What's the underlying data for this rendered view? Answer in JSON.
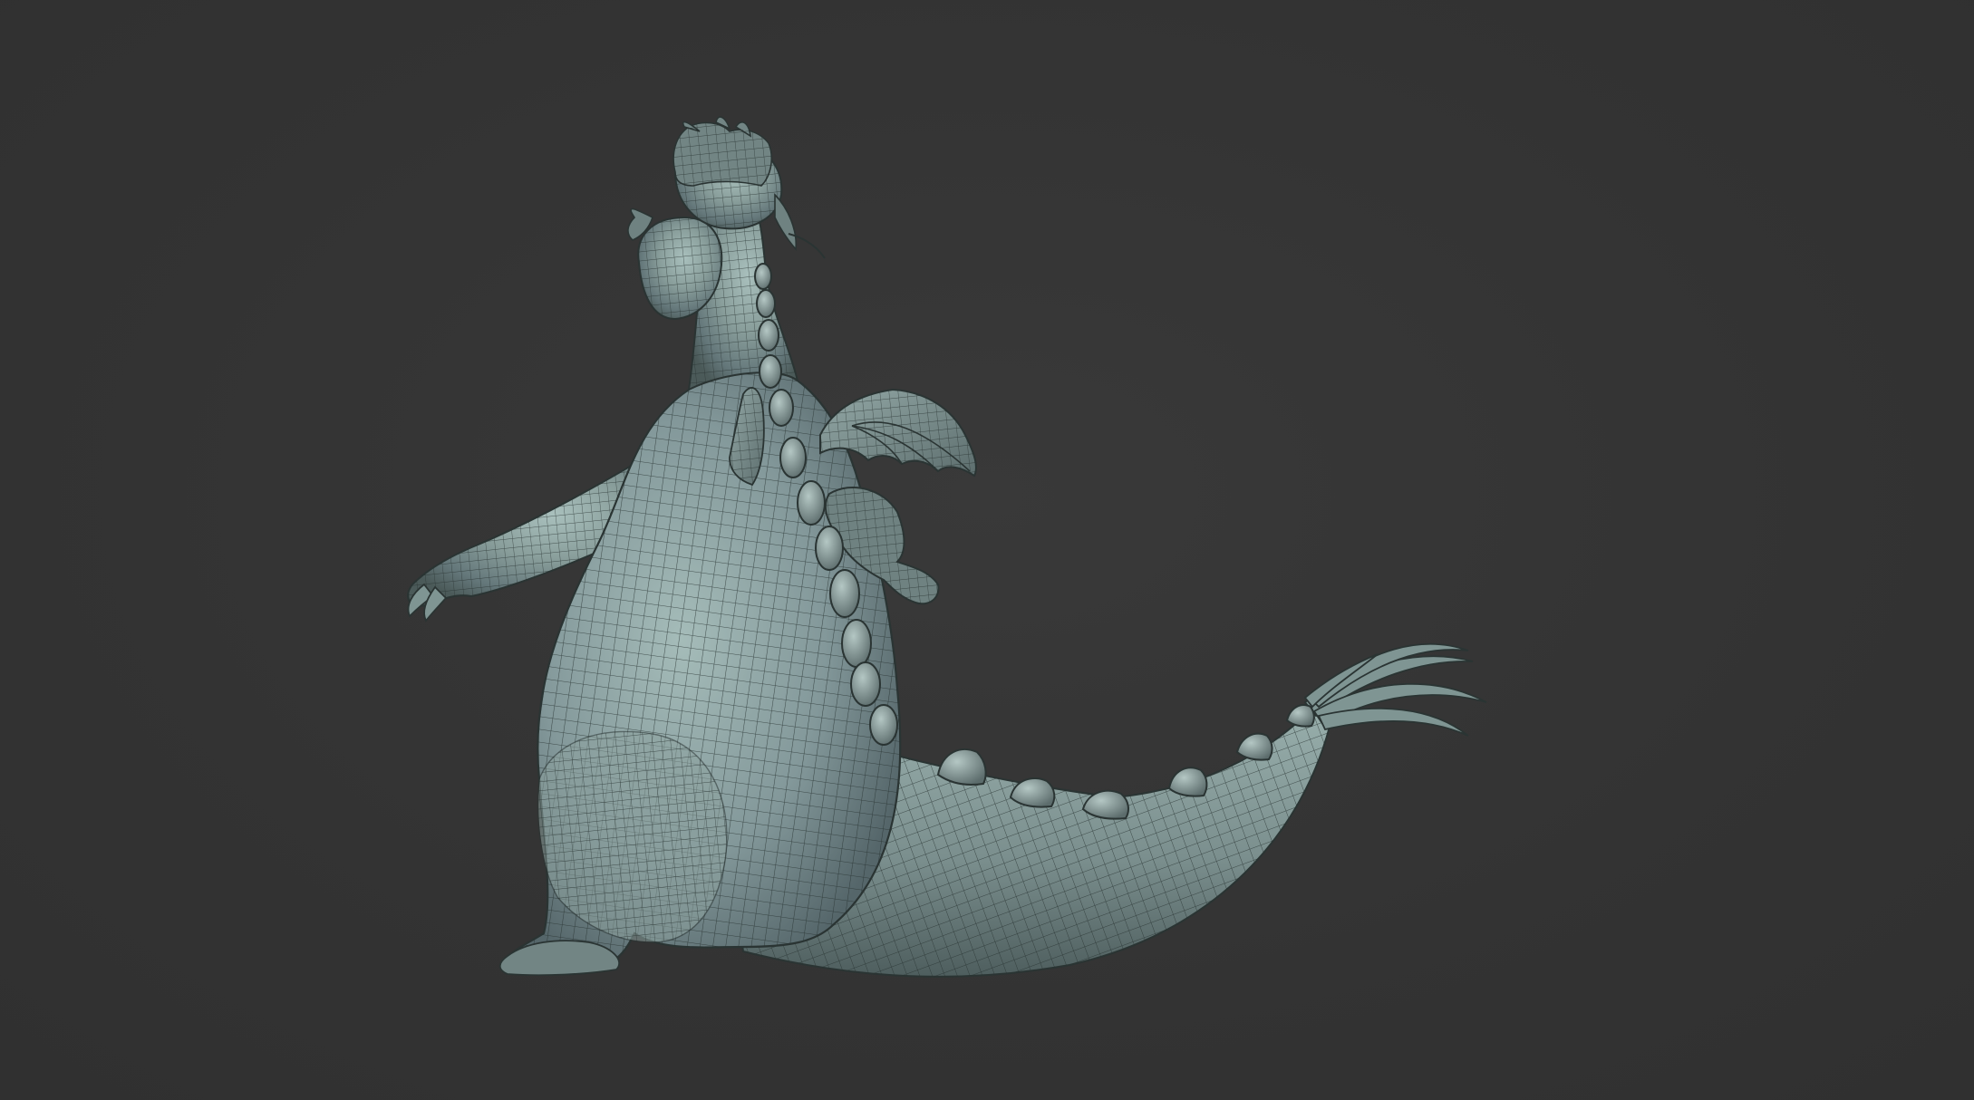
{
  "viewport": {
    "background_color": "#333333",
    "subject": "dragon-wireframe-model",
    "mesh_base_color": "#7f9593",
    "mesh_highlight_color": "#a9c0bd",
    "mesh_shadow_color": "#4b5a59",
    "wire_color": "#263130"
  }
}
